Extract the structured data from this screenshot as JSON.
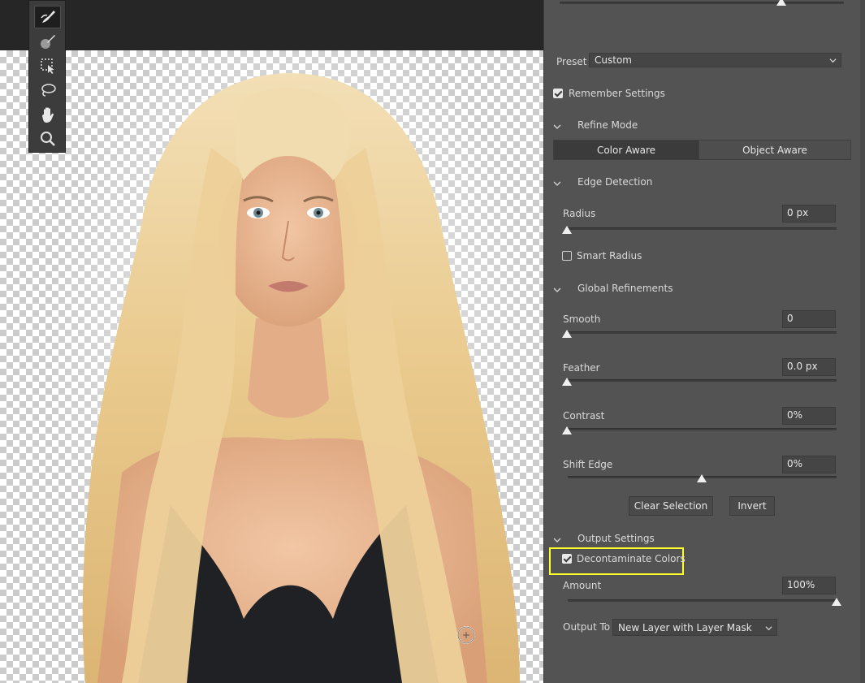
{
  "panel": {
    "preset": {
      "label": "Preset",
      "value": "Custom"
    },
    "remember_settings": {
      "label": "Remember Settings",
      "checked": true
    },
    "refine_mode": {
      "title": "Refine Mode",
      "options": [
        "Color Aware",
        "Object Aware"
      ],
      "selected": "Color Aware"
    },
    "edge_detection": {
      "title": "Edge Detection",
      "radius": {
        "label": "Radius",
        "value": "0 px",
        "level": 0
      },
      "smart_radius": {
        "label": "Smart Radius",
        "checked": false
      }
    },
    "global_refinements": {
      "title": "Global Refinements",
      "smooth": {
        "label": "Smooth",
        "value": "0",
        "level": 0
      },
      "feather": {
        "label": "Feather",
        "value": "0.0 px",
        "level": 0
      },
      "contrast": {
        "label": "Contrast",
        "value": "0%",
        "level": 0
      },
      "shift_edge": {
        "label": "Shift Edge",
        "value": "0%",
        "level": 0.5
      }
    },
    "buttons": {
      "clear_selection": "Clear Selection",
      "invert": "Invert"
    },
    "output_settings": {
      "title": "Output Settings",
      "decontaminate": {
        "label": "Decontaminate Colors",
        "checked": true
      },
      "amount": {
        "label": "Amount",
        "value": "100%",
        "level": 1.0
      },
      "output_to": {
        "label": "Output To",
        "value": "New Layer with Layer Mask"
      }
    },
    "top_slider_level": 0.8
  },
  "toolbar": {
    "tools": [
      "quick-selection-brush-icon",
      "refine-edge-brush-icon",
      "object-selection-icon",
      "lasso-icon",
      "hand-icon",
      "zoom-icon"
    ],
    "active": "quick-selection-brush-icon"
  },
  "colors": {
    "panel_bg": "#535353",
    "highlight": "#ffff2b",
    "canvas_dark": "#262626"
  }
}
